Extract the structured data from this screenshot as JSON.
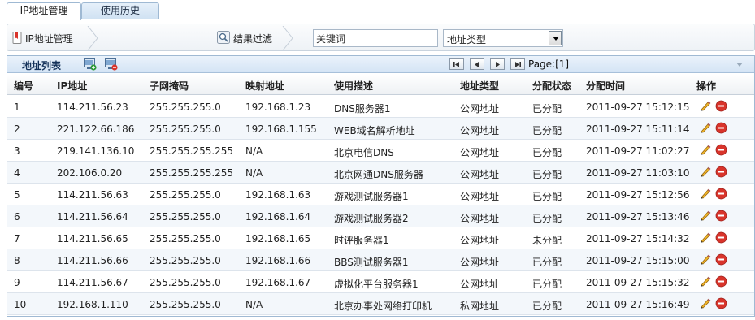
{
  "tabs": [
    {
      "label": "IP地址管理",
      "active": true
    },
    {
      "label": "使用历史",
      "active": false
    }
  ],
  "toolbar": {
    "breadcrumb_label": "IP地址管理",
    "filter_label": "结果过滤",
    "keyword_value": "关键词",
    "type_select_value": "地址类型"
  },
  "grid": {
    "title": "地址列表",
    "page_label": "Page:[1]",
    "columns": [
      "编号",
      "IP地址",
      "子网掩码",
      "映射地址",
      "使用描述",
      "地址类型",
      "分配状态",
      "分配时间",
      "操作"
    ],
    "rows": [
      {
        "id": "1",
        "ip": "114.211.56.23",
        "mask": "255.255.255.0",
        "mapped": "192.168.1.23",
        "desc": "DNS服务器1",
        "type": "公网地址",
        "status": "已分配",
        "time": "2011-09-27 15:12:15"
      },
      {
        "id": "2",
        "ip": "221.122.66.186",
        "mask": "255.255.255.0",
        "mapped": "192.168.1.155",
        "desc": "WEB域名解析地址",
        "type": "公网地址",
        "status": "已分配",
        "time": "2011-09-27 15:11:14"
      },
      {
        "id": "3",
        "ip": "219.141.136.10",
        "mask": "255.255.255.255",
        "mapped": "N/A",
        "desc": "北京电信DNS",
        "type": "公网地址",
        "status": "已分配",
        "time": "2011-09-27 11:02:27"
      },
      {
        "id": "4",
        "ip": "202.106.0.20",
        "mask": "255.255.255.255",
        "mapped": "N/A",
        "desc": "北京网通DNS服务器",
        "type": "公网地址",
        "status": "已分配",
        "time": "2011-09-27 11:03:10"
      },
      {
        "id": "5",
        "ip": "114.211.56.63",
        "mask": "255.255.255.0",
        "mapped": "192.168.1.63",
        "desc": "游戏测试服务器1",
        "type": "公网地址",
        "status": "已分配",
        "time": "2011-09-27 15:12:56"
      },
      {
        "id": "6",
        "ip": "114.211.56.64",
        "mask": "255.255.255.0",
        "mapped": "192.168.1.64",
        "desc": "游戏测试服务器2",
        "type": "公网地址",
        "status": "已分配",
        "time": "2011-09-27 15:13:46"
      },
      {
        "id": "7",
        "ip": "114.211.56.65",
        "mask": "255.255.255.0",
        "mapped": "192.168.1.65",
        "desc": "时评服务器1",
        "type": "公网地址",
        "status": "未分配",
        "time": "2011-09-27 15:14:32"
      },
      {
        "id": "8",
        "ip": "114.211.56.66",
        "mask": "255.255.255.0",
        "mapped": "192.168.1.66",
        "desc": "BBS测试服务器1",
        "type": "公网地址",
        "status": "已分配",
        "time": "2011-09-27 15:15:00"
      },
      {
        "id": "9",
        "ip": "114.211.56.67",
        "mask": "255.255.255.0",
        "mapped": "192.168.1.67",
        "desc": "虚拟化平台服务器1",
        "type": "公网地址",
        "status": "已分配",
        "time": "2011-09-27 15:15:32"
      },
      {
        "id": "10",
        "ip": "192.168.1.110",
        "mask": "255.255.255.0",
        "mapped": "N/A",
        "desc": "北京办事处网络打印机",
        "type": "私网地址",
        "status": "已分配",
        "time": "2011-09-27 15:16:49"
      }
    ]
  },
  "colors": {
    "accent_border": "#9fb9d3",
    "header_bar": "#d4e4f5",
    "alt_row": "#f3f7fb",
    "remove_red": "#d9342b",
    "edit_yellow": "#f0b429"
  }
}
